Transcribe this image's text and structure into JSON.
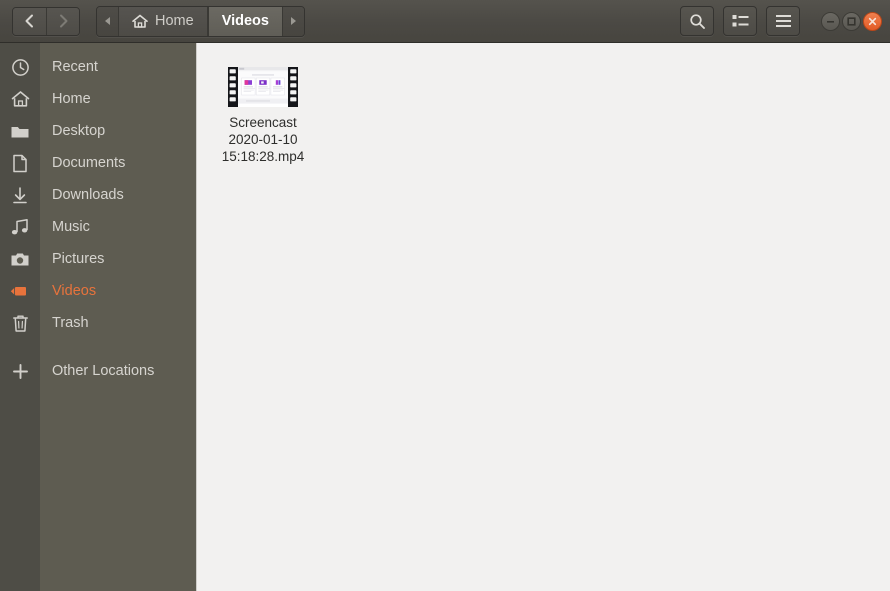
{
  "window": {
    "title": "Videos",
    "accent_color": "#e8733c",
    "header_bg": "#4b4944",
    "sidebar_bg": "#5e5c51",
    "content_bg": "#f2f1f0"
  },
  "header": {
    "nav": {
      "back_label": "Back",
      "back_icon": "chevron-left-icon",
      "forward_label": "Forward",
      "forward_icon": "chevron-right-icon"
    },
    "pathbar": {
      "scroll_left_icon": "triangle-left-icon",
      "scroll_right_icon": "triangle-right-icon",
      "crumbs": [
        {
          "label": "Home",
          "icon": "home-icon",
          "active": false
        },
        {
          "label": "Videos",
          "icon": "",
          "active": true
        }
      ]
    },
    "tools": [
      {
        "name": "search-button",
        "icon": "search-icon",
        "label": "Search"
      },
      {
        "name": "view-options-button",
        "icon": "list-view-icon",
        "label": "View options"
      },
      {
        "name": "main-menu-button",
        "icon": "hamburger-menu-icon",
        "label": "Menu"
      }
    ],
    "window_controls": [
      {
        "name": "minimize-button",
        "icon": "minimize-icon",
        "label": "Minimize"
      },
      {
        "name": "maximize-button",
        "icon": "maximize-icon",
        "label": "Maximize"
      },
      {
        "name": "close-button",
        "icon": "close-icon",
        "label": "Close"
      }
    ]
  },
  "sidebar": {
    "items": [
      {
        "label": "Recent",
        "icon": "clock-icon",
        "selected": false,
        "gap_before": false
      },
      {
        "label": "Home",
        "icon": "home-icon",
        "selected": false,
        "gap_before": false
      },
      {
        "label": "Desktop",
        "icon": "folder-icon",
        "selected": false,
        "gap_before": false
      },
      {
        "label": "Documents",
        "icon": "document-icon",
        "selected": false,
        "gap_before": false
      },
      {
        "label": "Downloads",
        "icon": "download-icon",
        "selected": false,
        "gap_before": false
      },
      {
        "label": "Music",
        "icon": "music-icon",
        "selected": false,
        "gap_before": false
      },
      {
        "label": "Pictures",
        "icon": "camera-icon",
        "selected": false,
        "gap_before": false
      },
      {
        "label": "Videos",
        "icon": "video-icon",
        "selected": true,
        "gap_before": false
      },
      {
        "label": "Trash",
        "icon": "trash-icon",
        "selected": false,
        "gap_before": false
      },
      {
        "label": "Other Locations",
        "icon": "plus-icon",
        "selected": false,
        "gap_before": true
      }
    ]
  },
  "content": {
    "files": [
      {
        "name": "Screencast 2020-01-10 15:18:28.mp4",
        "icon": "video-thumbnail",
        "selected": false
      }
    ]
  }
}
